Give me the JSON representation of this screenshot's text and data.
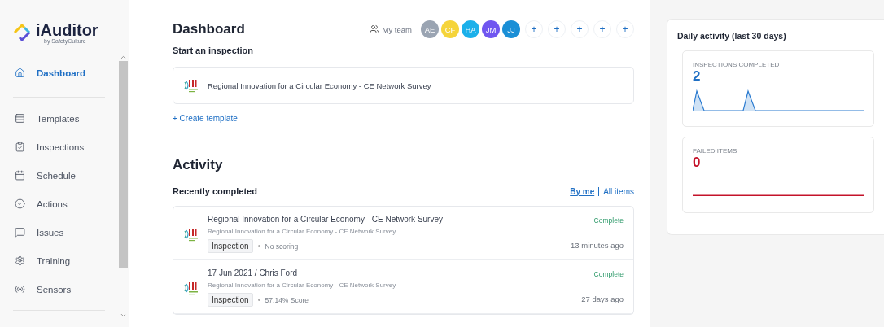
{
  "brand": {
    "name": "iAuditor",
    "tagline": "by SafetyCulture"
  },
  "sidebar": {
    "items": [
      {
        "kind": "home",
        "label": "Dashboard",
        "selected": true
      },
      {
        "kind": "templates",
        "label": "Templates",
        "selected": false
      },
      {
        "kind": "inspections",
        "label": "Inspections",
        "selected": false
      },
      {
        "kind": "schedule",
        "label": "Schedule",
        "selected": false
      },
      {
        "kind": "actions",
        "label": "Actions",
        "selected": false
      },
      {
        "kind": "issues",
        "label": "Issues",
        "selected": false
      },
      {
        "kind": "training",
        "label": "Training",
        "selected": false
      },
      {
        "kind": "sensors",
        "label": "Sensors",
        "selected": false
      }
    ]
  },
  "header": {
    "title": "Dashboard",
    "team_label": "My team",
    "avatars": [
      {
        "initials": "AE",
        "color": "#9aa4b2"
      },
      {
        "initials": "CF",
        "color": "#f5d43a"
      },
      {
        "initials": "HA",
        "color": "#1bb0ea"
      },
      {
        "initials": "JM",
        "color": "#7056f0"
      },
      {
        "initials": "JJ",
        "color": "#1a8fd6"
      }
    ],
    "add_slots": [
      "+",
      "+",
      "+",
      "+",
      "+"
    ]
  },
  "start": {
    "heading": "Start an inspection",
    "templates": [
      "Regional Innovation for a Circular Economy - CE Network Survey"
    ],
    "create_link": "+ Create template"
  },
  "activity": {
    "title": "Activity",
    "subtitle": "Recently completed",
    "filters": [
      {
        "label": "By me",
        "selected": true
      },
      {
        "label": "All items",
        "selected": false
      }
    ],
    "rows": [
      {
        "title": "Regional Innovation for a Circular Economy - CE Network Survey",
        "template": "Regional Innovation for a Circular Economy - CE Network Survey",
        "tag": "Inspection",
        "detail": "No scoring",
        "status": "Complete",
        "time": "13 minutes ago"
      },
      {
        "title": "17 Jun 2021 / Chris Ford",
        "template": "Regional Innovation for a Circular Economy - CE Network Survey",
        "tag": "Inspection",
        "detail": "57.14% Score",
        "status": "Complete",
        "time": "27 days ago"
      }
    ]
  },
  "daily": {
    "title": "Daily activity (last 30 days)",
    "stats": [
      {
        "kind": "inspections",
        "label": "INSPECTIONS COMPLETED",
        "value": "2"
      },
      {
        "kind": "failed",
        "label": "FAILED ITEMS",
        "value": "0"
      }
    ]
  }
}
